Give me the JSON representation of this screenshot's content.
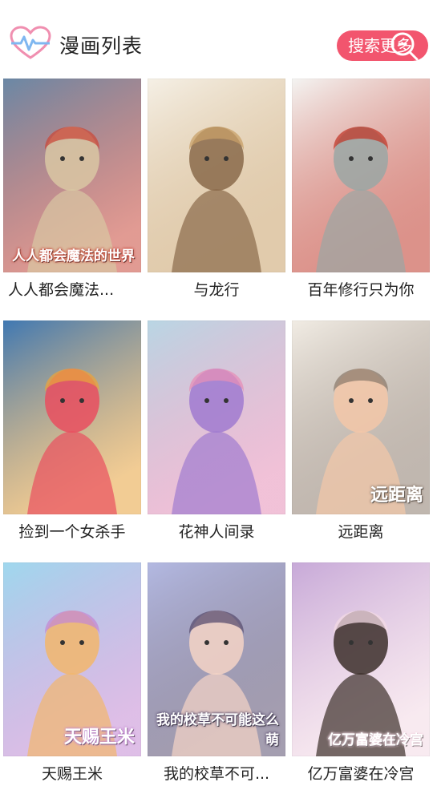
{
  "header": {
    "title": "漫画列表",
    "search_label": "搜索更多",
    "logo_icon": "heart-pulse-icon",
    "search_icon": "search-icon",
    "accent": "#f2556e"
  },
  "comics": [
    {
      "title": "人人都会魔法...",
      "cover_text": "人人都会魔法的世界",
      "palette": [
        "#6a88a6",
        "#d9c7a3",
        "#c9493b"
      ]
    },
    {
      "title": "与龙行",
      "cover_text": "",
      "palette": [
        "#f5f0e6",
        "#8a6a4a",
        "#c8a068"
      ]
    },
    {
      "title": "百年修行只为你",
      "cover_text": "",
      "palette": [
        "#f4f4f2",
        "#9aa7a4",
        "#c0392b"
      ]
    },
    {
      "title": "捡到一个女杀手",
      "cover_text": "",
      "palette": [
        "#3f78b3",
        "#e94e5f",
        "#e8a33d"
      ]
    },
    {
      "title": "花神人间录",
      "cover_text": "",
      "palette": [
        "#b9d6e4",
        "#a07ad0",
        "#e58fb7"
      ]
    },
    {
      "title": "远距离",
      "cover_text": "远距离",
      "palette": [
        "#f1ece4",
        "#f3c7a8",
        "#8d7c6e"
      ]
    },
    {
      "title": "天赐王米",
      "cover_text": "天赐王米",
      "palette": [
        "#9fd8ee",
        "#f2b66b",
        "#c48ad3"
      ]
    },
    {
      "title": "我的校草不可...",
      "cover_text": "我的校草不可能这么萌",
      "palette": [
        "#b3b9e2",
        "#f5d4c6",
        "#5a4e6f"
      ]
    },
    {
      "title": "亿万富婆在冷宫",
      "cover_text": "亿万富婆在冷宫",
      "palette": [
        "#c7a9d8",
        "#3c2f2a",
        "#f3d9e4"
      ]
    }
  ]
}
